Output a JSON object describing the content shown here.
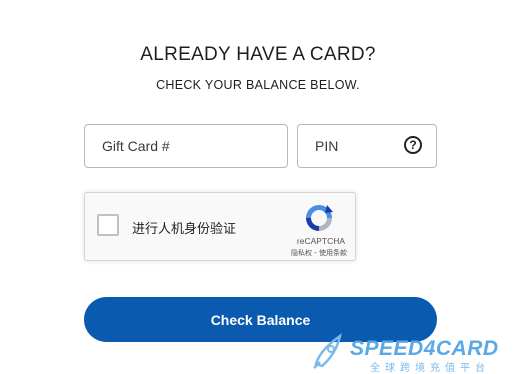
{
  "header": {
    "title": "ALREADY HAVE A CARD?",
    "subtitle": "CHECK YOUR BALANCE BELOW."
  },
  "form": {
    "gift_card_placeholder": "Gift Card #",
    "pin_placeholder": "PIN",
    "help_symbol": "?",
    "check_balance_label": "Check Balance"
  },
  "recaptcha": {
    "label": "进行人机身份验证",
    "brand": "reCAPTCHA",
    "links": "隐私权 - 使用条款"
  },
  "watermark": {
    "brand": "SPEED4CARD",
    "tagline": "全球跨境充值平台"
  },
  "colors": {
    "primary_button": "#0a5ab0",
    "watermark": "#5aa8e6"
  }
}
